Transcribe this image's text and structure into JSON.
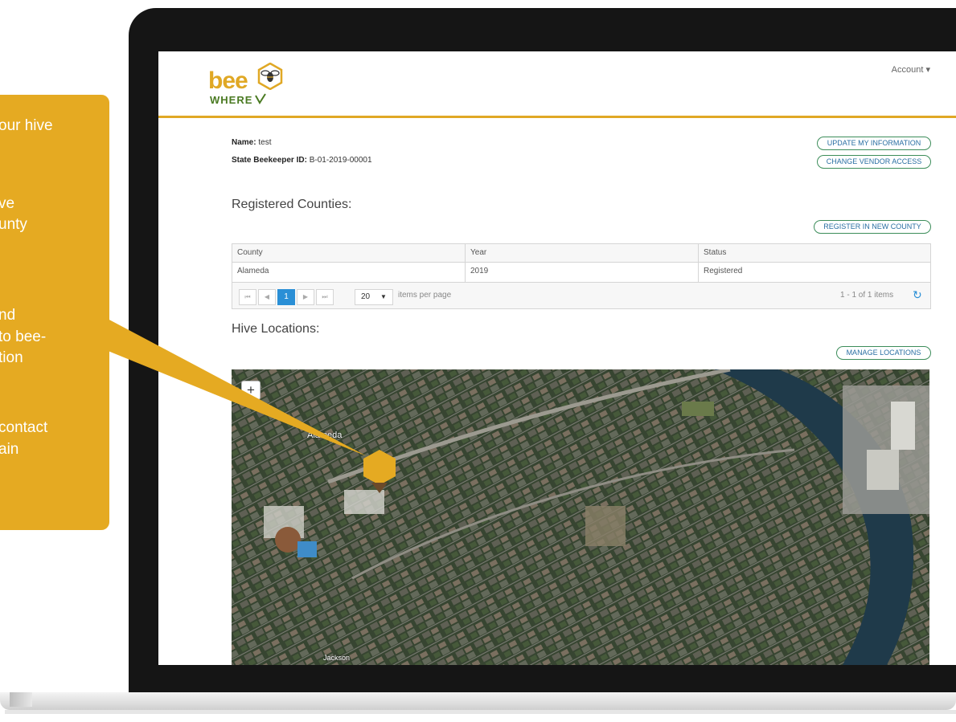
{
  "callout": {
    "lines": [
      "our hive",
      "ve",
      "unty",
      "nd",
      "to bee-",
      "tion",
      "contact",
      "ain"
    ],
    "color": "#e5aa22"
  },
  "header": {
    "logo_text": "bee",
    "logo_subtext": "WHERE",
    "account_label": "Account ▾"
  },
  "profile": {
    "name_label": "Name:",
    "name_value": "test",
    "id_label": "State Beekeeper ID:",
    "id_value": "B-01-2019-00001",
    "update_button": "UPDATE MY INFORMATION",
    "vendor_button": "CHANGE VENDOR ACCESS"
  },
  "counties": {
    "title": "Registered Counties:",
    "register_button": "REGISTER IN NEW COUNTY",
    "columns": [
      "County",
      "Year",
      "Status"
    ],
    "rows": [
      [
        "Alameda",
        "2019",
        "Registered"
      ]
    ],
    "pager": {
      "first": "⏮",
      "prev": "◀",
      "current_page": "1",
      "next": "▶",
      "last": "⏭",
      "page_size": "20",
      "page_size_caret": "▼",
      "items_per_page": "items per page",
      "range_text": "1 - 1 of 1 items",
      "refresh_icon": "↻"
    }
  },
  "hives": {
    "title": "Hive Locations:",
    "manage_button": "MANAGE LOCATIONS",
    "map": {
      "zoom_in": "+",
      "labels": [
        "Alameda",
        "Jackson"
      ],
      "hive_marker_color": "#e5aa22"
    }
  }
}
